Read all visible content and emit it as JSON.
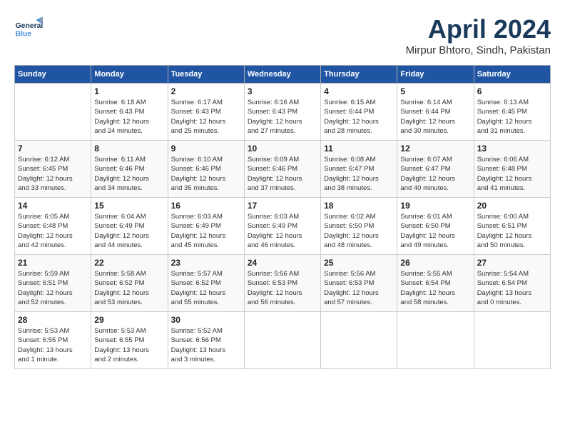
{
  "header": {
    "logo_general": "General",
    "logo_blue": "Blue",
    "month": "April 2024",
    "location": "Mirpur Bhtoro, Sindh, Pakistan"
  },
  "columns": [
    "Sunday",
    "Monday",
    "Tuesday",
    "Wednesday",
    "Thursday",
    "Friday",
    "Saturday"
  ],
  "weeks": [
    [
      {
        "day": "",
        "info": ""
      },
      {
        "day": "1",
        "info": "Sunrise: 6:18 AM\nSunset: 6:43 PM\nDaylight: 12 hours\nand 24 minutes."
      },
      {
        "day": "2",
        "info": "Sunrise: 6:17 AM\nSunset: 6:43 PM\nDaylight: 12 hours\nand 25 minutes."
      },
      {
        "day": "3",
        "info": "Sunrise: 6:16 AM\nSunset: 6:43 PM\nDaylight: 12 hours\nand 27 minutes."
      },
      {
        "day": "4",
        "info": "Sunrise: 6:15 AM\nSunset: 6:44 PM\nDaylight: 12 hours\nand 28 minutes."
      },
      {
        "day": "5",
        "info": "Sunrise: 6:14 AM\nSunset: 6:44 PM\nDaylight: 12 hours\nand 30 minutes."
      },
      {
        "day": "6",
        "info": "Sunrise: 6:13 AM\nSunset: 6:45 PM\nDaylight: 12 hours\nand 31 minutes."
      }
    ],
    [
      {
        "day": "7",
        "info": "Sunrise: 6:12 AM\nSunset: 6:45 PM\nDaylight: 12 hours\nand 33 minutes."
      },
      {
        "day": "8",
        "info": "Sunrise: 6:11 AM\nSunset: 6:46 PM\nDaylight: 12 hours\nand 34 minutes."
      },
      {
        "day": "9",
        "info": "Sunrise: 6:10 AM\nSunset: 6:46 PM\nDaylight: 12 hours\nand 35 minutes."
      },
      {
        "day": "10",
        "info": "Sunrise: 6:09 AM\nSunset: 6:46 PM\nDaylight: 12 hours\nand 37 minutes."
      },
      {
        "day": "11",
        "info": "Sunrise: 6:08 AM\nSunset: 6:47 PM\nDaylight: 12 hours\nand 38 minutes."
      },
      {
        "day": "12",
        "info": "Sunrise: 6:07 AM\nSunset: 6:47 PM\nDaylight: 12 hours\nand 40 minutes."
      },
      {
        "day": "13",
        "info": "Sunrise: 6:06 AM\nSunset: 6:48 PM\nDaylight: 12 hours\nand 41 minutes."
      }
    ],
    [
      {
        "day": "14",
        "info": "Sunrise: 6:05 AM\nSunset: 6:48 PM\nDaylight: 12 hours\nand 42 minutes."
      },
      {
        "day": "15",
        "info": "Sunrise: 6:04 AM\nSunset: 6:49 PM\nDaylight: 12 hours\nand 44 minutes."
      },
      {
        "day": "16",
        "info": "Sunrise: 6:03 AM\nSunset: 6:49 PM\nDaylight: 12 hours\nand 45 minutes."
      },
      {
        "day": "17",
        "info": "Sunrise: 6:03 AM\nSunset: 6:49 PM\nDaylight: 12 hours\nand 46 minutes."
      },
      {
        "day": "18",
        "info": "Sunrise: 6:02 AM\nSunset: 6:50 PM\nDaylight: 12 hours\nand 48 minutes."
      },
      {
        "day": "19",
        "info": "Sunrise: 6:01 AM\nSunset: 6:50 PM\nDaylight: 12 hours\nand 49 minutes."
      },
      {
        "day": "20",
        "info": "Sunrise: 6:00 AM\nSunset: 6:51 PM\nDaylight: 12 hours\nand 50 minutes."
      }
    ],
    [
      {
        "day": "21",
        "info": "Sunrise: 5:59 AM\nSunset: 6:51 PM\nDaylight: 12 hours\nand 52 minutes."
      },
      {
        "day": "22",
        "info": "Sunrise: 5:58 AM\nSunset: 6:52 PM\nDaylight: 12 hours\nand 53 minutes."
      },
      {
        "day": "23",
        "info": "Sunrise: 5:57 AM\nSunset: 6:52 PM\nDaylight: 12 hours\nand 55 minutes."
      },
      {
        "day": "24",
        "info": "Sunrise: 5:56 AM\nSunset: 6:53 PM\nDaylight: 12 hours\nand 56 minutes."
      },
      {
        "day": "25",
        "info": "Sunrise: 5:56 AM\nSunset: 6:53 PM\nDaylight: 12 hours\nand 57 minutes."
      },
      {
        "day": "26",
        "info": "Sunrise: 5:55 AM\nSunset: 6:54 PM\nDaylight: 12 hours\nand 58 minutes."
      },
      {
        "day": "27",
        "info": "Sunrise: 5:54 AM\nSunset: 6:54 PM\nDaylight: 13 hours\nand 0 minutes."
      }
    ],
    [
      {
        "day": "28",
        "info": "Sunrise: 5:53 AM\nSunset: 6:55 PM\nDaylight: 13 hours\nand 1 minute."
      },
      {
        "day": "29",
        "info": "Sunrise: 5:53 AM\nSunset: 6:55 PM\nDaylight: 13 hours\nand 2 minutes."
      },
      {
        "day": "30",
        "info": "Sunrise: 5:52 AM\nSunset: 6:56 PM\nDaylight: 13 hours\nand 3 minutes."
      },
      {
        "day": "",
        "info": ""
      },
      {
        "day": "",
        "info": ""
      },
      {
        "day": "",
        "info": ""
      },
      {
        "day": "",
        "info": ""
      }
    ]
  ]
}
